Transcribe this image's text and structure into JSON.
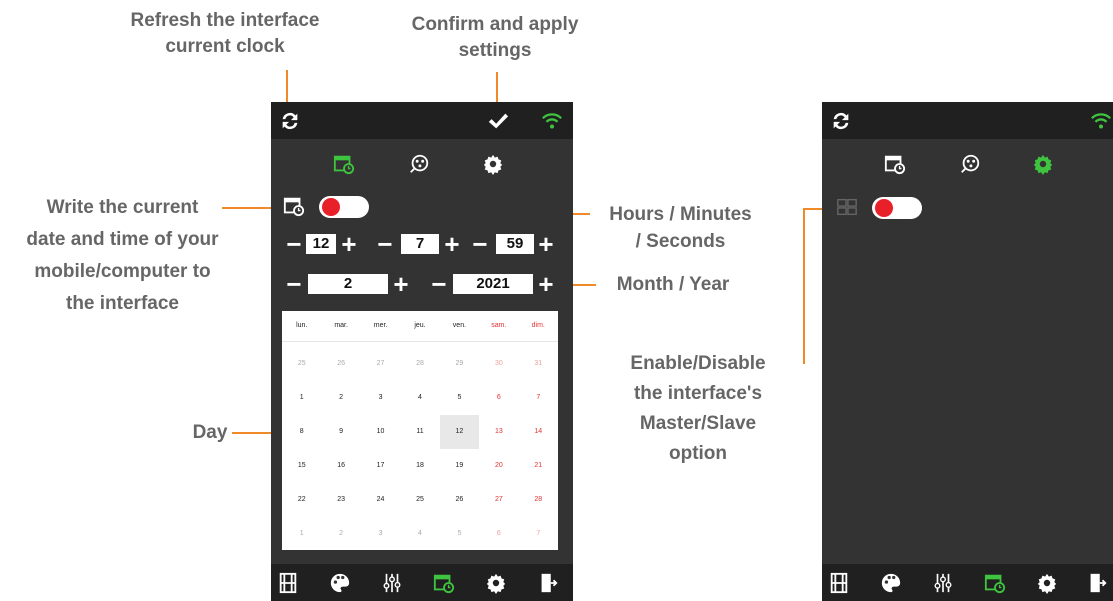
{
  "annotations": {
    "refresh": "Refresh the interface\ncurrent clock",
    "confirm": "Confirm and apply\nsettings",
    "write_date": "Write the current\ndate and time of your\nmobile/computer to\nthe interface",
    "hms": "Hours / Minutes\n/ Seconds",
    "month_year": "Month / Year",
    "day": "Day",
    "master_slave": "Enable/Disable\nthe interface's\nMaster/Slave\noption"
  },
  "icons": {
    "refresh": "refresh-icon",
    "confirm": "checkmark-icon",
    "wifi": "wifi-icon",
    "calendar_clock": "calendar-clock-icon",
    "dmx": "dmx-connector-icon",
    "gear": "gear-icon",
    "film": "film-icon",
    "palette": "palette-icon",
    "sliders": "sliders-icon",
    "exit": "exit-icon"
  },
  "colors": {
    "accent": "#3ec43e",
    "toggle_knob": "#e8202a",
    "annotation_line": "#f08a28",
    "weekend": "#e33232"
  },
  "left_screen": {
    "time": {
      "hours": "12",
      "minutes": "7",
      "seconds": "59"
    },
    "date": {
      "month": "2",
      "year": "2021"
    },
    "calendar": {
      "weekdays": [
        "lun.",
        "mar.",
        "mer.",
        "jeu.",
        "ven.",
        "sam.",
        "dim."
      ],
      "rows": [
        [
          "25",
          "26",
          "27",
          "28",
          "29",
          "30",
          "31"
        ],
        [
          "1",
          "2",
          "3",
          "4",
          "5",
          "6",
          "7"
        ],
        [
          "8",
          "9",
          "10",
          "11",
          "12",
          "13",
          "14"
        ],
        [
          "15",
          "16",
          "17",
          "18",
          "19",
          "20",
          "21"
        ],
        [
          "22",
          "23",
          "24",
          "25",
          "26",
          "27",
          "28"
        ],
        [
          "1",
          "2",
          "3",
          "4",
          "5",
          "6",
          "7"
        ]
      ],
      "selected_day": "12"
    },
    "minus": "−",
    "plus": "+"
  }
}
